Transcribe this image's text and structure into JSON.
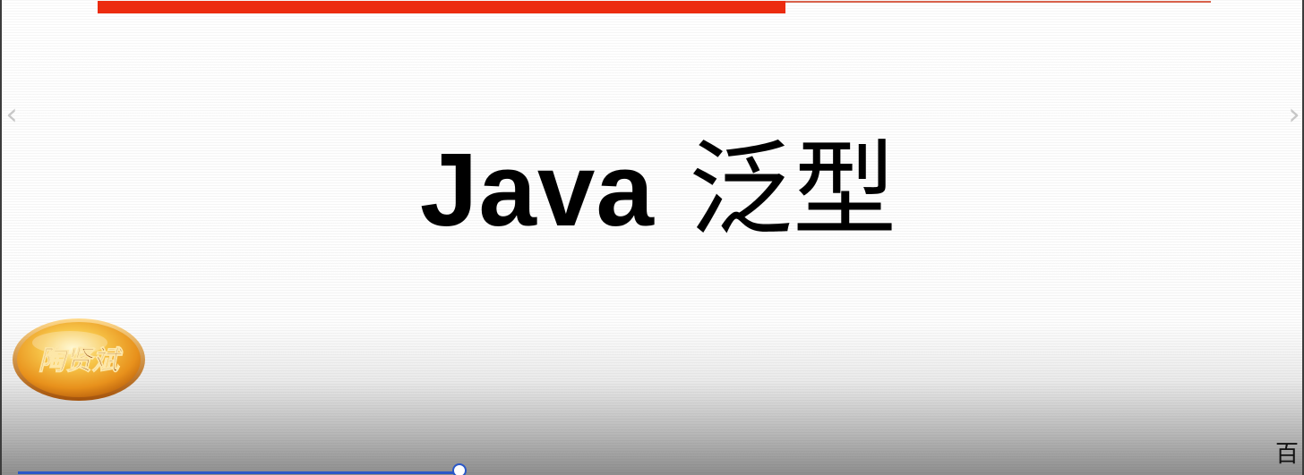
{
  "slide": {
    "title_latin": "Java",
    "title_cjk": "泛型",
    "logo_text": "陶贤斌",
    "corner_text": "百"
  },
  "navigation": {
    "prev_icon": "chevron-left-icon",
    "prev_glyph": "‹",
    "next_icon": "chevron-right-icon",
    "next_glyph": "›"
  },
  "header_progress": {
    "fraction": 0.618
  },
  "playback": {
    "fraction": 0.352
  },
  "colors": {
    "header_progress": "#ec2b0f",
    "header_thin_line": "#d9624b",
    "playback_progress": "#2a57c7",
    "logo_orange": "#e8911c",
    "logo_text": "#8a3d08",
    "title_text": "#000000"
  }
}
